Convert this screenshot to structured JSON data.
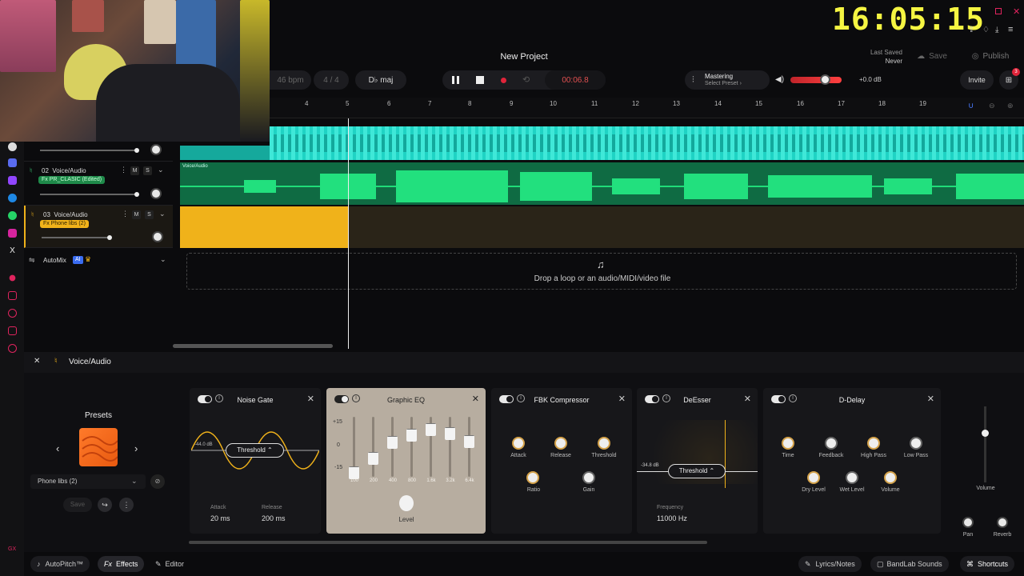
{
  "overlay": {
    "clock": "16:05:15"
  },
  "header": {
    "project_title": "New Project",
    "last_saved_label": "Last Saved",
    "last_saved_value": "Never",
    "save_label": "Save",
    "publish_label": "Publish",
    "invite_label": "Invite",
    "cart_badge": "3"
  },
  "transport": {
    "bpm": "46 bpm",
    "time_sig": "4 / 4",
    "key": "D♭ maj",
    "time": "00:06.8"
  },
  "mastering": {
    "title": "Mastering",
    "preset": "Select Preset ›"
  },
  "volume": {
    "db": "+0.0 dB",
    "level": 0.8
  },
  "ruler": {
    "bars": [
      "4",
      "5",
      "6",
      "7",
      "8",
      "9",
      "10",
      "11",
      "12",
      "13",
      "14",
      "15",
      "16",
      "17",
      "18",
      "19"
    ]
  },
  "tracks": [
    {
      "num": "02",
      "name": "Voice/Audio",
      "fx": "Fx PR_CLASIC (Edited)",
      "m": "M",
      "s": "S",
      "region_label": "Voice/Audio"
    },
    {
      "num": "03",
      "name": "Voice/Audio",
      "fx": "Fx Phone libs (2)",
      "m": "M",
      "s": "S"
    }
  ],
  "automix": {
    "label": "AutoMix",
    "badge": "AI"
  },
  "drop_zone": {
    "text": "Drop a loop or an audio/MIDI/video file"
  },
  "fx_panel": {
    "track_name": "Voice/Audio",
    "presets_title": "Presets",
    "preset_value": "Phone libs (2)",
    "save_label": "Save",
    "cards": {
      "noise_gate": {
        "title": "Noise Gate",
        "threshold_label": "Threshold",
        "level_db": "-44.0 dB",
        "attack_label": "Attack",
        "attack_value": "20 ms",
        "release_label": "Release",
        "release_value": "200 ms"
      },
      "graphic_eq": {
        "title": "Graphic EQ",
        "scale": [
          "+15",
          "0",
          "-15"
        ],
        "bands": [
          "100",
          "200",
          "400",
          "800",
          "1.6k",
          "3.2k",
          "6.4k"
        ],
        "level_label": "Level"
      },
      "fbk": {
        "title": "FBK Compressor",
        "knobs": [
          "Attack",
          "Release",
          "Threshold",
          "Ratio",
          "Gain"
        ]
      },
      "deesser": {
        "title": "DeEsser",
        "threshold_label": "Threshold",
        "level_db": "-34.8 dB",
        "freq_label": "Frequency",
        "freq_value": "11000 Hz"
      },
      "delay": {
        "title": "D-Delay",
        "knobs": [
          "Time",
          "Feedback",
          "High Pass",
          "Low Pass",
          "Dry Level",
          "Wet Level",
          "Volume"
        ]
      }
    },
    "master": {
      "volume_label": "Volume",
      "pan_label": "Pan",
      "reverb_label": "Reverb"
    }
  },
  "bottom": {
    "autopitch": "AutoPitch™",
    "effects": "Effects",
    "editor": "Editor",
    "lyrics": "Lyrics/Notes",
    "bandlab": "BandLab Sounds",
    "shortcuts": "Shortcuts"
  }
}
